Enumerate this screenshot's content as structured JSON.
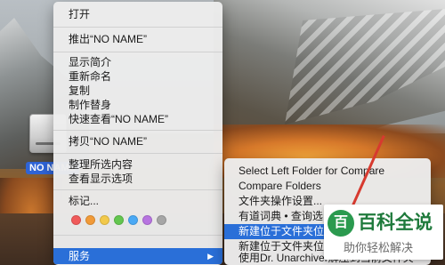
{
  "desktop": {
    "drive_label": "NO NAME"
  },
  "context_menu": {
    "items": [
      {
        "label": "打开"
      },
      {
        "label": "推出“NO NAME”"
      },
      {
        "label": "显示简介"
      },
      {
        "label": "重新命名"
      },
      {
        "label": "复制"
      },
      {
        "label": "制作替身"
      },
      {
        "label": "快速查看“NO NAME”"
      },
      {
        "label": "拷贝“NO NAME”"
      },
      {
        "label": "整理所选内容"
      },
      {
        "label": "查看显示选项"
      },
      {
        "label": "标记..."
      },
      {
        "label": "服务",
        "arrow": "▶"
      }
    ],
    "tag_colors": [
      "#f05a5a",
      "#f19a38",
      "#f2c94a",
      "#63c64f",
      "#4aa9f5",
      "#b774e0",
      "#a6a6a6"
    ]
  },
  "submenu": {
    "items": [
      {
        "label": "Select Left Folder for Compare"
      },
      {
        "label": "Compare Folders"
      },
      {
        "label": "文件夹操作设置..."
      },
      {
        "label": "有道词典 • 查询选中文字"
      },
      {
        "label": "新建位于文件夹位置的终端窗口"
      },
      {
        "label": "新建位于文件夹位置的终端标签页"
      },
      {
        "label": "使用Dr. Unarchiver解压到当前文件夹"
      }
    ]
  },
  "watermark": {
    "title": "百科全说",
    "subtitle": "助你轻松解决",
    "logo_glyph": "百"
  },
  "colors": {
    "highlight": "#2a6fd8",
    "annotation": "#d73a2f",
    "watermark_green": "#1f7a3c"
  }
}
